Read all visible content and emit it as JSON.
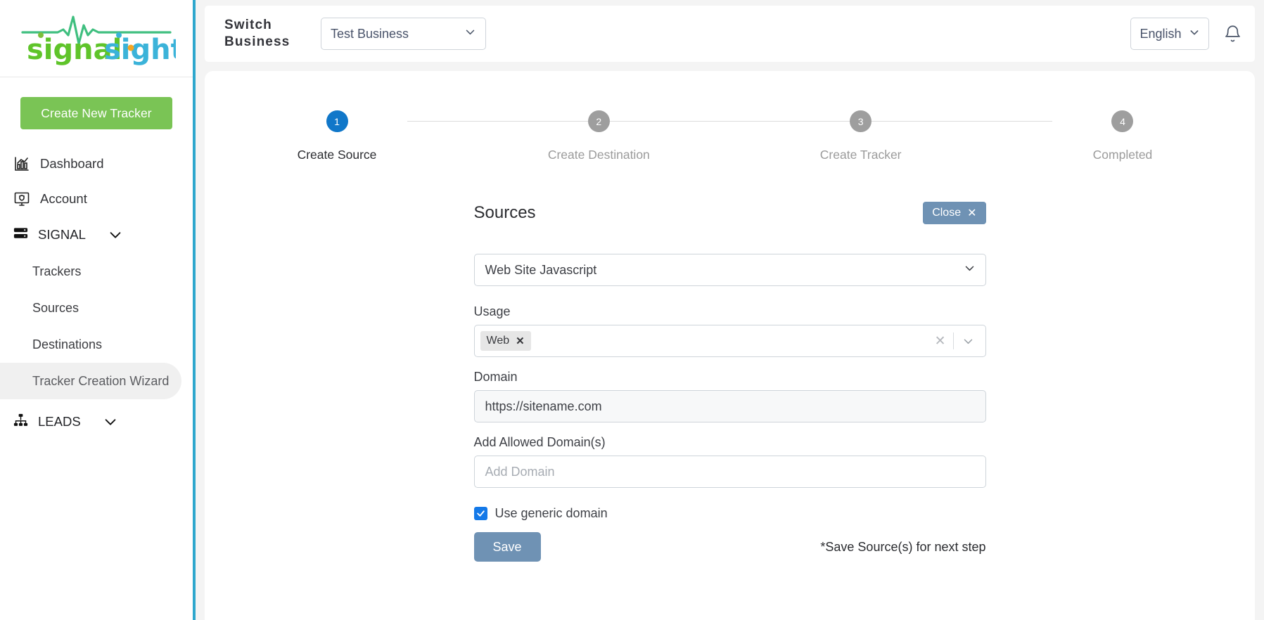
{
  "brand": {
    "logo_text_primary": "signal",
    "logo_text_secondary": "sight",
    "color_green": "#5fc42a",
    "color_blue": "#3bb3d9",
    "color_accent_bar": "#2ea7cd",
    "color_orange": "#f5a623"
  },
  "sidebar": {
    "create_button": "Create New Tracker",
    "items": [
      {
        "label": "Dashboard",
        "icon": "chart-bar-icon"
      },
      {
        "label": "Account",
        "icon": "monitor-shield-icon"
      }
    ],
    "groups": [
      {
        "label": "SIGNAL",
        "icon": "server-icon",
        "chevron": "chevron-down-icon"
      },
      {
        "label": "LEADS",
        "icon": "sitemap-icon",
        "chevron": "chevron-down-icon"
      }
    ],
    "signal_children": [
      {
        "label": "Trackers",
        "active": false
      },
      {
        "label": "Sources",
        "active": false
      },
      {
        "label": "Destinations",
        "active": false
      },
      {
        "label": "Tracker Creation Wizard",
        "active": true
      }
    ]
  },
  "topbar": {
    "switch_business_label": "Switch Business",
    "business_select": {
      "value": "Test Business",
      "options": [
        "Test Business"
      ]
    },
    "language_select": {
      "value": "English",
      "options": [
        "English"
      ]
    },
    "notification_icon": "bell-icon"
  },
  "stepper": {
    "steps": [
      {
        "number": "1",
        "label": "Create Source",
        "active": true
      },
      {
        "number": "2",
        "label": "Create Destination",
        "active": false
      },
      {
        "number": "3",
        "label": "Create Tracker",
        "active": false
      },
      {
        "number": "4",
        "label": "Completed",
        "active": false
      }
    ],
    "active_color": "#1077c9",
    "inactive_color": "#9e9e9e"
  },
  "panel": {
    "title": "Sources",
    "close_label": "Close",
    "close_icon": "close-x-icon",
    "source_type": {
      "value": "Web Site Javascript",
      "options": [
        "Web Site Javascript"
      ]
    },
    "usage": {
      "label": "Usage",
      "tags": [
        {
          "label": "Web",
          "remove_icon": "chip-remove-icon"
        }
      ],
      "clear_icon": "clear-all-icon",
      "dropdown_icon": "chevron-down-icon"
    },
    "domain": {
      "label": "Domain",
      "value": "https://sitename.com",
      "readonly": true
    },
    "allowed_domains": {
      "label": "Add Allowed Domain(s)",
      "value": "",
      "placeholder": "Add Domain"
    },
    "generic_domain": {
      "label": "Use generic domain",
      "checked": true
    },
    "save_label": "Save",
    "save_note": "*Save Source(s) for next step",
    "button_color": "#6f92b4"
  }
}
